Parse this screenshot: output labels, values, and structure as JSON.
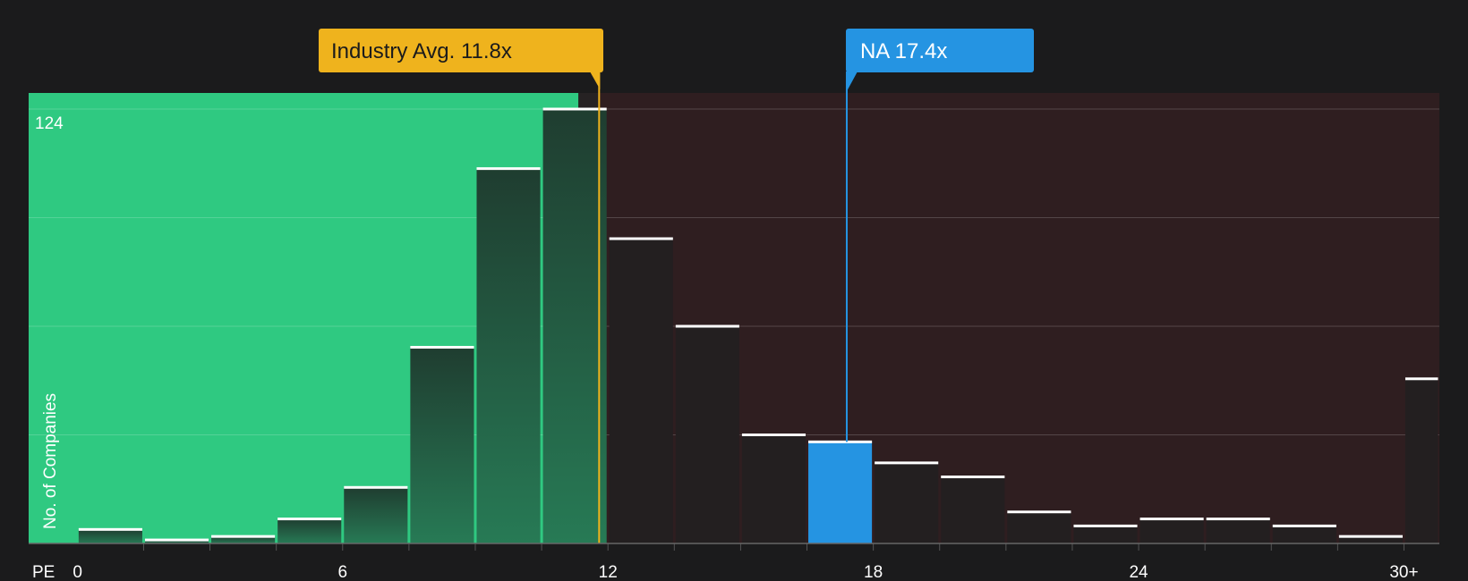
{
  "chart_data": {
    "type": "bar",
    "x_label": "PE",
    "y_label": "No. of Companies",
    "y_max_label": "124",
    "ylim": [
      0,
      124
    ],
    "x_ticks": [
      {
        "value": 0,
        "label": "0"
      },
      {
        "value": 6,
        "label": "6"
      },
      {
        "value": 12,
        "label": "12"
      },
      {
        "value": 18,
        "label": "18"
      },
      {
        "value": 24,
        "label": "24"
      },
      {
        "value": 30,
        "label": "30+"
      }
    ],
    "x_range": [
      -1.1,
      30.8
    ],
    "bin_edges": [
      0,
      1.5,
      3,
      4.5,
      6,
      7.5,
      9,
      10.5,
      12,
      13.5,
      15,
      16.5,
      18,
      19.5,
      21,
      22.5,
      24,
      25.5,
      27,
      28.5,
      30,
      30.8
    ],
    "values": [
      4,
      1,
      2,
      7,
      16,
      56,
      107,
      124,
      87,
      62,
      31,
      29,
      23,
      19,
      9,
      5,
      7,
      7,
      5,
      2,
      47
    ],
    "highlight_bin_index": 11,
    "markers": [
      {
        "name": "industry-avg",
        "label": "Industry Avg. 11.8x",
        "value": 11.8,
        "color": "#efb31d"
      },
      {
        "name": "company",
        "label": "NA 17.4x",
        "value": 17.4,
        "color": "#2594e2"
      }
    ],
    "zones": {
      "undervalued_color": "#2fc981",
      "overvalued_color": "#2f1e20"
    },
    "grid": true
  }
}
